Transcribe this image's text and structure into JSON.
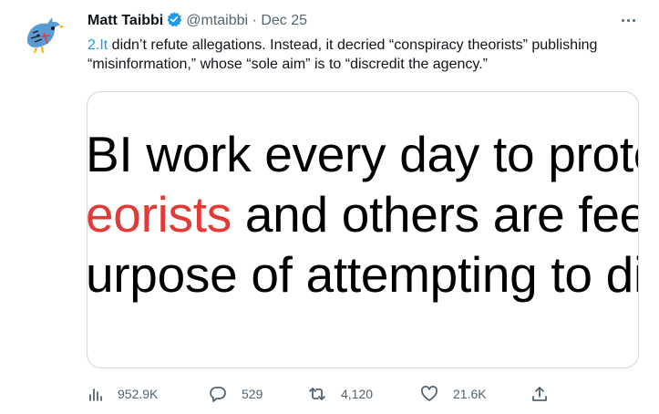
{
  "author": {
    "name": "Matt Taibbi",
    "handle": "@mtaibbi",
    "separator": "·",
    "date": "Dec 25"
  },
  "tweet": {
    "link_text": "2.It",
    "text": " didn’t refute allegations. Instead, it decried “conspiracy theorists” publishing “misinformation,” whose “sole aim” is to “discredit the agency.”"
  },
  "media": {
    "line1": "BI work every day to prote",
    "line2_red": "eorists",
    "line2_rest": " and others are fee",
    "line3": "urpose of attempting to di",
    "highlight_color": "#e53935"
  },
  "actions": {
    "views": "952.9K",
    "replies": "529",
    "retweets": "4,120",
    "likes": "21.6K"
  },
  "icons": {
    "avatar": "blue-bird-illustration-icon",
    "verified": "verified-badge-icon",
    "more": "more-dots-icon",
    "views": "bar-chart-icon",
    "reply": "speech-bubble-icon",
    "retweet": "retweet-arrows-icon",
    "like": "heart-icon",
    "share": "share-upload-icon"
  },
  "colors": {
    "link": "#1d9bf0",
    "verified": "#1d9bf0",
    "secondary_text": "#536471",
    "border": "#cfd9de"
  }
}
